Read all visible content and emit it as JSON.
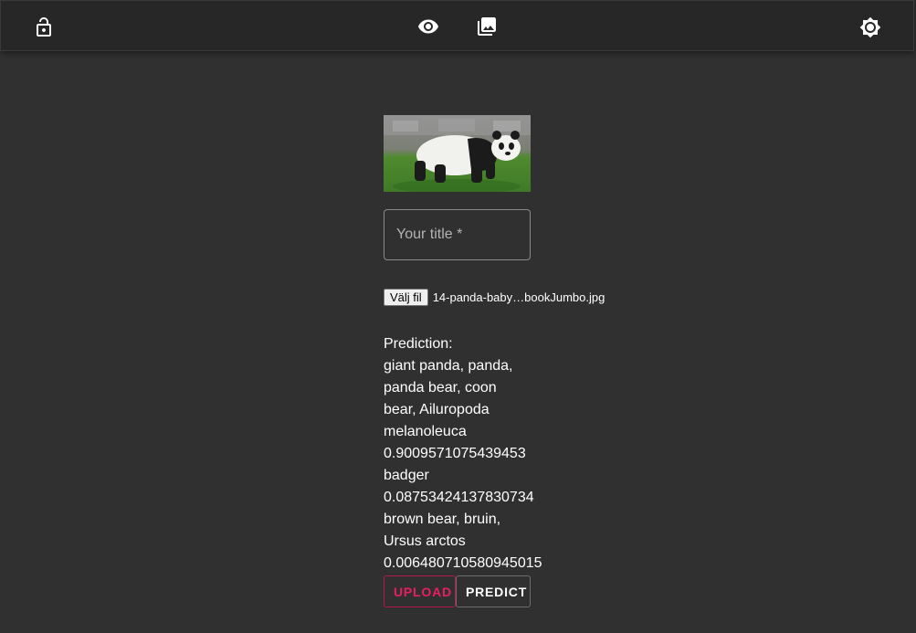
{
  "appbar": {
    "left_icon": "lock-open-icon",
    "center_icons": [
      "eye-icon",
      "photo-library-icon"
    ],
    "right_icon": "brightness-icon"
  },
  "preview": {
    "alt": "giant panda"
  },
  "form": {
    "title_placeholder": "Your title *",
    "title_value": "",
    "file_button_label": "Välj fil",
    "file_name": "14-panda-baby…bookJumbo.jpg"
  },
  "prediction": {
    "lines": [
      "Prediction:",
      "giant panda, panda,",
      "panda bear, coon",
      "bear, Ailuropoda",
      "melanoleuca",
      "0.9009571075439453",
      "badger",
      "0.08753424137830734",
      "brown bear, bruin,",
      "Ursus arctos",
      "0.006480710580945015"
    ]
  },
  "actions": {
    "upload_label": "UPLOAD",
    "predict_label": "PREDICT"
  },
  "colors": {
    "background": "#303030",
    "appbar": "#272727",
    "accent": "#e91e63"
  }
}
